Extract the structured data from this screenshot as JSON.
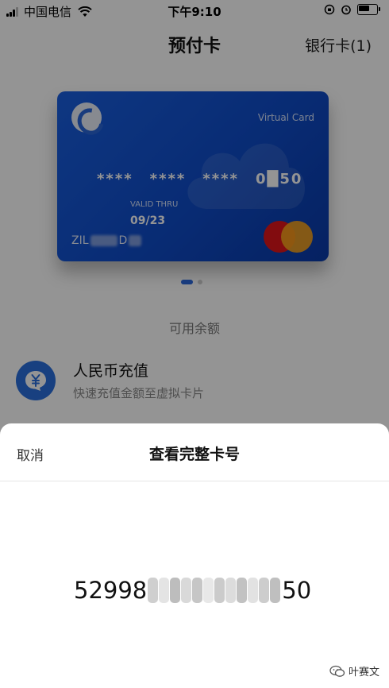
{
  "status_bar": {
    "carrier": "中国电信",
    "time": "下午9:10"
  },
  "nav": {
    "title": "预付卡",
    "right_link": "银行卡(1)"
  },
  "card": {
    "type_label": "Virtual Card",
    "number_groups": [
      "****",
      "****",
      "****",
      "0█50"
    ],
    "valid_label": "VALID THRU",
    "valid_date": "09/23",
    "holder_prefix": "ZIL",
    "holder_middle": "D",
    "network": "mastercard"
  },
  "balance": {
    "label": "可用余额"
  },
  "topup": {
    "icon": "yuan-chat-icon",
    "title": "人民币充值",
    "subtitle": "快速充值金额至虚拟卡片"
  },
  "sheet": {
    "cancel_label": "取消",
    "title": "查看完整卡号",
    "number_visible_start": "52998",
    "number_visible_end": "50"
  },
  "watermark": {
    "text": "叶赛文"
  },
  "colors": {
    "accent": "#2a66d8",
    "card_blue": "#1a5fe0",
    "overlay": "rgba(0,0,0,0.42)"
  }
}
